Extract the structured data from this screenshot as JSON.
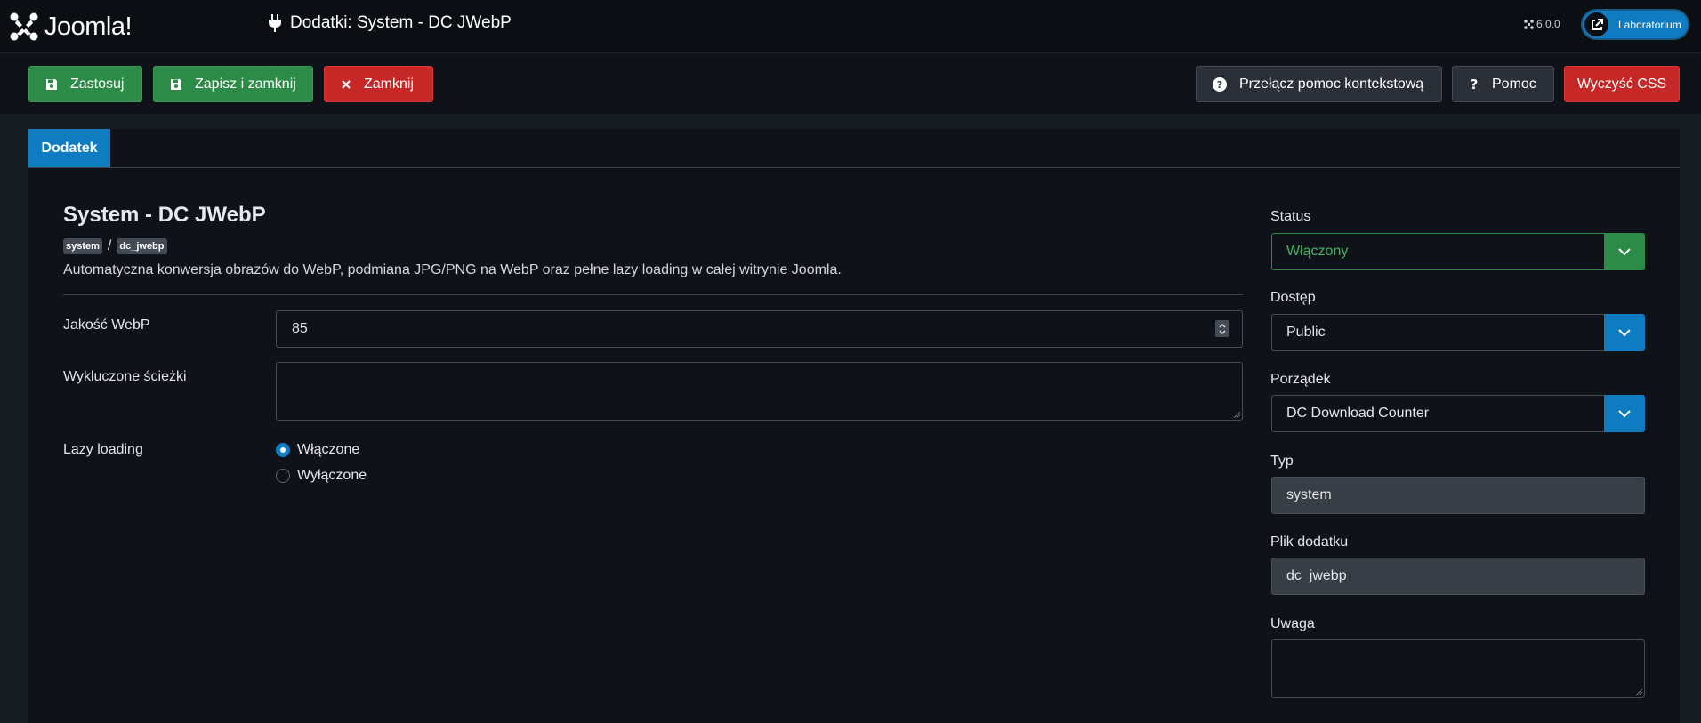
{
  "header": {
    "logo_text": "Joomla!",
    "page_title": "Dodatki: System - DC JWebP",
    "version": "6.0.0",
    "site_button_label": "Laboratorium"
  },
  "toolbar": {
    "apply_label": "Zastosuj",
    "save_close_label": "Zapisz i zamknij",
    "close_label": "Zamknij",
    "context_help_label": "Przełącz pomoc kontekstową",
    "help_label": "Pomoc",
    "clear_css_label": "Wyczyść CSS"
  },
  "tabs": [
    {
      "label": "Dodatek",
      "active": true
    }
  ],
  "extension": {
    "title": "System - DC JWebP",
    "badges": [
      "system",
      "dc_jwebp"
    ],
    "separator": "/",
    "description": "Automatyczna konwersja obrazów do WebP, podmiana JPG/PNG na WebP oraz pełne lazy loading w całej witrynie Joomla."
  },
  "fields": {
    "quality": {
      "label": "Jakość WebP",
      "value": "85"
    },
    "excluded": {
      "label": "Wykluczone ścieżki",
      "value": ""
    },
    "lazy": {
      "label": "Lazy loading",
      "options": [
        {
          "label": "Włączone",
          "checked": true
        },
        {
          "label": "Wyłączone",
          "checked": false
        }
      ]
    }
  },
  "sidebar": {
    "status": {
      "label": "Status",
      "value": "Włączony"
    },
    "access": {
      "label": "Dostęp",
      "value": "Public"
    },
    "ordering": {
      "label": "Porządek",
      "value": "DC Download Counter"
    },
    "type": {
      "label": "Typ",
      "value": "system"
    },
    "plugin_file": {
      "label": "Plik dodatku",
      "value": "dc_jwebp"
    },
    "note": {
      "label": "Uwaga",
      "value": ""
    }
  },
  "colors": {
    "green": "#2d8b48",
    "red": "#c52827",
    "blue": "#0f7cc2",
    "status_text": "#45b365"
  }
}
